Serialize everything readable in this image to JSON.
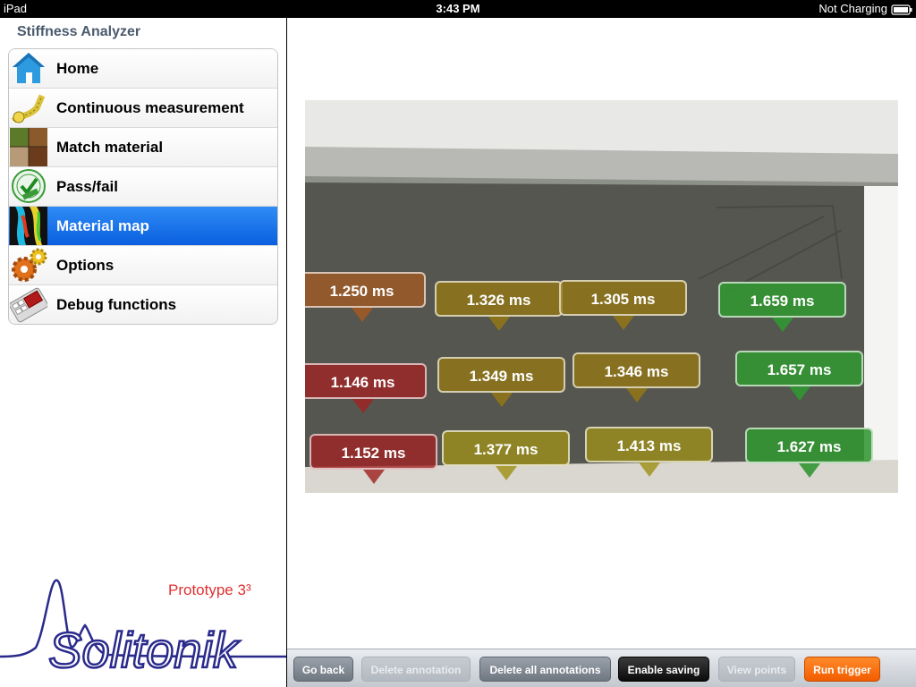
{
  "status_bar": {
    "device": "iPad",
    "time": "3:43 PM",
    "charging": "Not Charging"
  },
  "sidebar": {
    "title": "Stiffness Analyzer",
    "items": [
      {
        "label": "Home",
        "icon": "home-icon",
        "selected": false
      },
      {
        "label": "Continuous measurement",
        "icon": "tape-measure-icon",
        "selected": false
      },
      {
        "label": "Match material",
        "icon": "material-texture-icon",
        "selected": false
      },
      {
        "label": "Pass/fail",
        "icon": "approved-stamp-icon",
        "selected": false
      },
      {
        "label": "Material map",
        "icon": "heatmap-icon",
        "selected": true
      },
      {
        "label": "Options",
        "icon": "gears-icon",
        "selected": false
      },
      {
        "label": "Debug functions",
        "icon": "keyboard-icon",
        "selected": false
      }
    ],
    "brand": "Solitonik",
    "prototype_label": "Prototype 3³"
  },
  "annotations": [
    {
      "value": "1.250 ms",
      "color": "brown"
    },
    {
      "value": "1.326 ms",
      "color": "olive"
    },
    {
      "value": "1.305 ms",
      "color": "olive"
    },
    {
      "value": "1.659 ms",
      "color": "green"
    },
    {
      "value": "1.146 ms",
      "color": "red"
    },
    {
      "value": "1.349 ms",
      "color": "olive"
    },
    {
      "value": "1.346 ms",
      "color": "olive"
    },
    {
      "value": "1.657 ms",
      "color": "green"
    },
    {
      "value": "1.152 ms",
      "color": "red"
    },
    {
      "value": "1.377 ms",
      "color": "yolive"
    },
    {
      "value": "1.413 ms",
      "color": "yolive"
    },
    {
      "value": "1.627 ms",
      "color": "green"
    }
  ],
  "toolbar": {
    "go_back": "Go back",
    "delete_annotation": "Delete annotation",
    "delete_all": "Delete all annotations",
    "enable_saving": "Enable saving",
    "view_points": "View points",
    "run_trigger": "Run trigger"
  },
  "colors": {
    "selected_row": "#0a5fe0",
    "run_trigger": "#f25d00",
    "prototype_text": "#e03030",
    "brand_text": "#2a2a8c"
  }
}
